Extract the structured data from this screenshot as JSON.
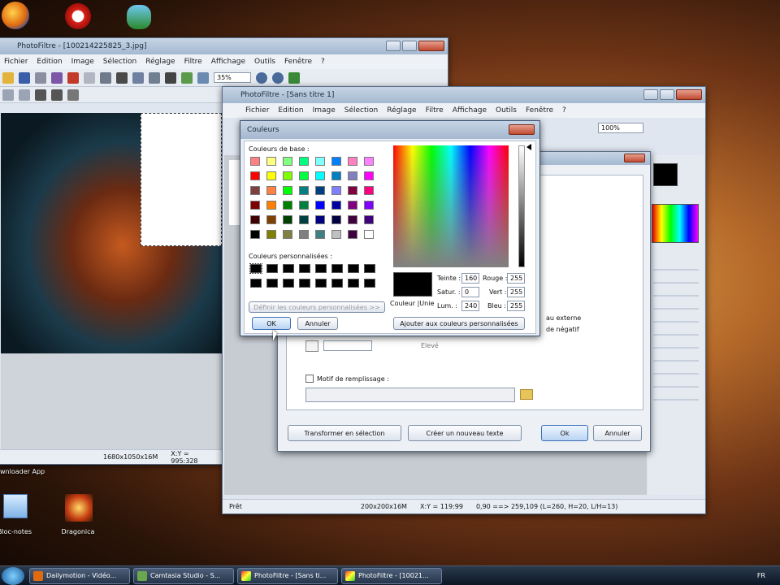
{
  "desktop": {
    "top_icon_label": "wnloader App",
    "icons": [
      {
        "label": "Bloc-notes"
      },
      {
        "label": "Dragonica"
      }
    ]
  },
  "back_window": {
    "title": "PhotoFiltre - [100214225825_3.jpg]",
    "menu": [
      "Fichier",
      "Edition",
      "Image",
      "Sélection",
      "Réglage",
      "Filtre",
      "Affichage",
      "Outils",
      "Fenêtre",
      "?"
    ],
    "zoom": "35%",
    "status": [
      "1680x1050x16M",
      "X:Y = 995:328"
    ]
  },
  "front_window": {
    "title": "PhotoFiltre - [Sans titre 1]",
    "menu": [
      "Fichier",
      "Edition",
      "Image",
      "Sélection",
      "Réglage",
      "Filtre",
      "Affichage",
      "Outils",
      "Fenêtre",
      "?"
    ],
    "zoom": "100%",
    "status": [
      "Prêt",
      "200x200x16M",
      "X:Y = 119:99",
      "0,90 ==> 259,109 (L=260, H=20, L/H=13)"
    ]
  },
  "text_dialog": {
    "visible_fragments": [
      "au externe",
      "de négatif",
      "Elevé"
    ],
    "fill_label": "Motif de remplissage :",
    "buttons": {
      "transform": "Transformer en sélection",
      "new_text": "Créer un nouveau texte",
      "ok": "Ok",
      "cancel": "Annuler"
    }
  },
  "color_dialog": {
    "title": "Couleurs",
    "basic_label": "Couleurs de base :",
    "custom_label": "Couleurs personnalisées :",
    "define_button": "Définir les couleurs personnalisées >>",
    "ok": "OK",
    "cancel": "Annuler",
    "add_button": "Ajouter aux couleurs personnalisées",
    "solid_label": "Couleur |Unie",
    "fields": {
      "teinte_label": "Teinte :",
      "teinte": "160",
      "satur_label": "Satur. :",
      "satur": "0",
      "lum_label": "Lum. :",
      "lum": "240",
      "rouge_label": "Rouge :",
      "rouge": "255",
      "vert_label": "Vert :",
      "vert": "255",
      "bleu_label": "Bleu :",
      "bleu": "255"
    },
    "basic_colors": [
      [
        "#ff8080",
        "#ffff80",
        "#80ff80",
        "#00ff80",
        "#80ffff",
        "#0080ff",
        "#ff80c0",
        "#ff80ff"
      ],
      [
        "#ff0000",
        "#ffff00",
        "#80ff00",
        "#00ff40",
        "#00ffff",
        "#0080c0",
        "#8080c0",
        "#ff00ff"
      ],
      [
        "#804040",
        "#ff8040",
        "#00ff00",
        "#008080",
        "#004080",
        "#8080ff",
        "#800040",
        "#ff0080"
      ],
      [
        "#800000",
        "#ff8000",
        "#008000",
        "#008040",
        "#0000ff",
        "#0000a0",
        "#800080",
        "#8000ff"
      ],
      [
        "#400000",
        "#804000",
        "#004000",
        "#004040",
        "#000080",
        "#000040",
        "#400040",
        "#400080"
      ],
      [
        "#000000",
        "#808000",
        "#808040",
        "#808080",
        "#408080",
        "#c0c0c0",
        "#400040",
        "#ffffff"
      ]
    ]
  },
  "taskbar": {
    "tasks": [
      {
        "label": "Dailymotion - Vidéo..."
      },
      {
        "label": "Camtasia Studio - S..."
      },
      {
        "label": "PhotoFiltre - [Sans ti..."
      },
      {
        "label": "PhotoFiltre - [10021..."
      }
    ],
    "lang": "FR"
  }
}
